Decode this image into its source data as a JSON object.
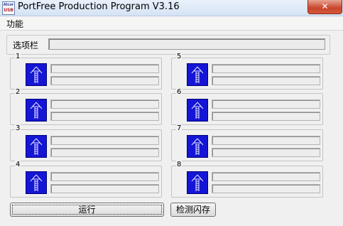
{
  "window": {
    "title": "PortFree Production Program V3.16",
    "icon_top": "Alcor",
    "icon_bottom": "USB",
    "close_label": "✕"
  },
  "menu": {
    "items": [
      "功能"
    ]
  },
  "options": {
    "label": "选项栏",
    "value": ""
  },
  "ports": [
    {
      "id": "1"
    },
    {
      "id": "2"
    },
    {
      "id": "3"
    },
    {
      "id": "4"
    },
    {
      "id": "5"
    },
    {
      "id": "6"
    },
    {
      "id": "7"
    },
    {
      "id": "8"
    }
  ],
  "buttons": {
    "run": "运行",
    "check_flash": "检测闪存"
  },
  "colors": {
    "port_icon_bg": "#1515d6",
    "close_button": "#c7462c"
  }
}
